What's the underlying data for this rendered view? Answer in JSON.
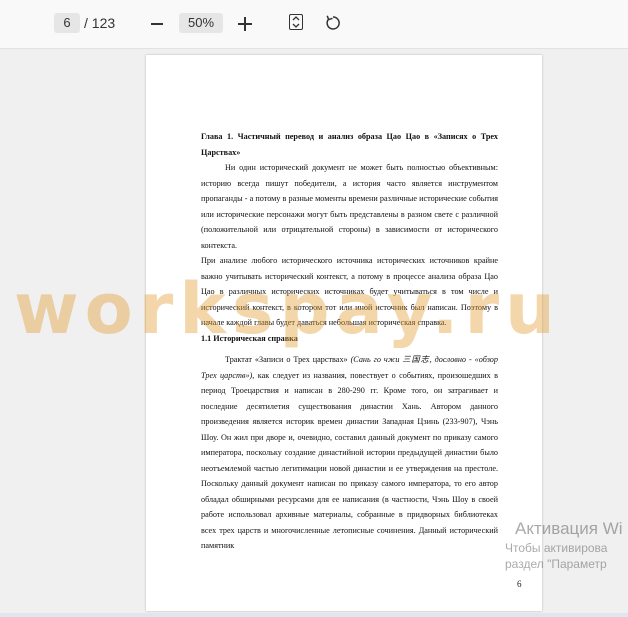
{
  "toolbar": {
    "page_current": "6",
    "page_total": "/ 123",
    "zoom": "50%",
    "zoom_out_icon": "minus-icon",
    "zoom_in_icon": "plus-icon",
    "fit_icon": "fit-page-icon",
    "rotate_icon": "rotate-icon"
  },
  "document": {
    "chapter_title": "Глава 1. Частичный перевод и анализ образа Цао Цао в «Записях о Трех Царствах»",
    "para1": "Ни один исторический документ не может быть полностью объективным: историю всегда пишут победители, а история часто является инструментом пропаганды - а потому в разные моменты времени различные исторические события или исторические персонажи могут быть представлены в разном свете с различной (положительной или отрицательной стороны) в зависимости от исторического контекста.",
    "para2": "При анализе любого исторического источника исторических источников крайне важно учитывать исторический контекст, а потому в процессе анализа образа Цао Цао в различных исторических источниках будет учитываться в том числе и исторический контекст, в котором тот или иной источник был написан. Поэтому в начале каждой главы будет даваться небольшая историческая справка.",
    "section_title": "1.1 Историческая справка",
    "para3_start": "Трактат «Записи о Трех царствах» ",
    "para3_italic": "(Сань го чжи 三国志, дословно - «обзор Трех царств»)",
    "para3_rest": ", как следует из названия, повествует о событиях, произошедших в период Троецарствия и написан в 280-290 гг. Кроме того, он затрагивает и последние десятилетия существования династии Хань. Автором данного произведения является историк времен династии Западная Цзинь (233-907), Чэнь Шоу. Он жил при дворе и, очевидно, составил данный документ по приказу самого императора, поскольку создание династийной истории предыдущей династии было неотъемлемой частью легитимации новой династии и ее утверждения на престоле. Поскольку данный документ написан по приказу самого императора, то его автор обладал обширными ресурсами для ее написания (в частности, Чэнь Шоу в своей работе использовал архивные материалы, собранные в придворных библиотеках всех трех царств и многочисленные летописные сочинения. Данный исторический памятник",
    "page_number": "6"
  },
  "watermark": "workspay.ru",
  "activation": {
    "title": "Активация Wi",
    "line1": "Чтобы активирова",
    "line2": "раздел \"Параметр"
  }
}
